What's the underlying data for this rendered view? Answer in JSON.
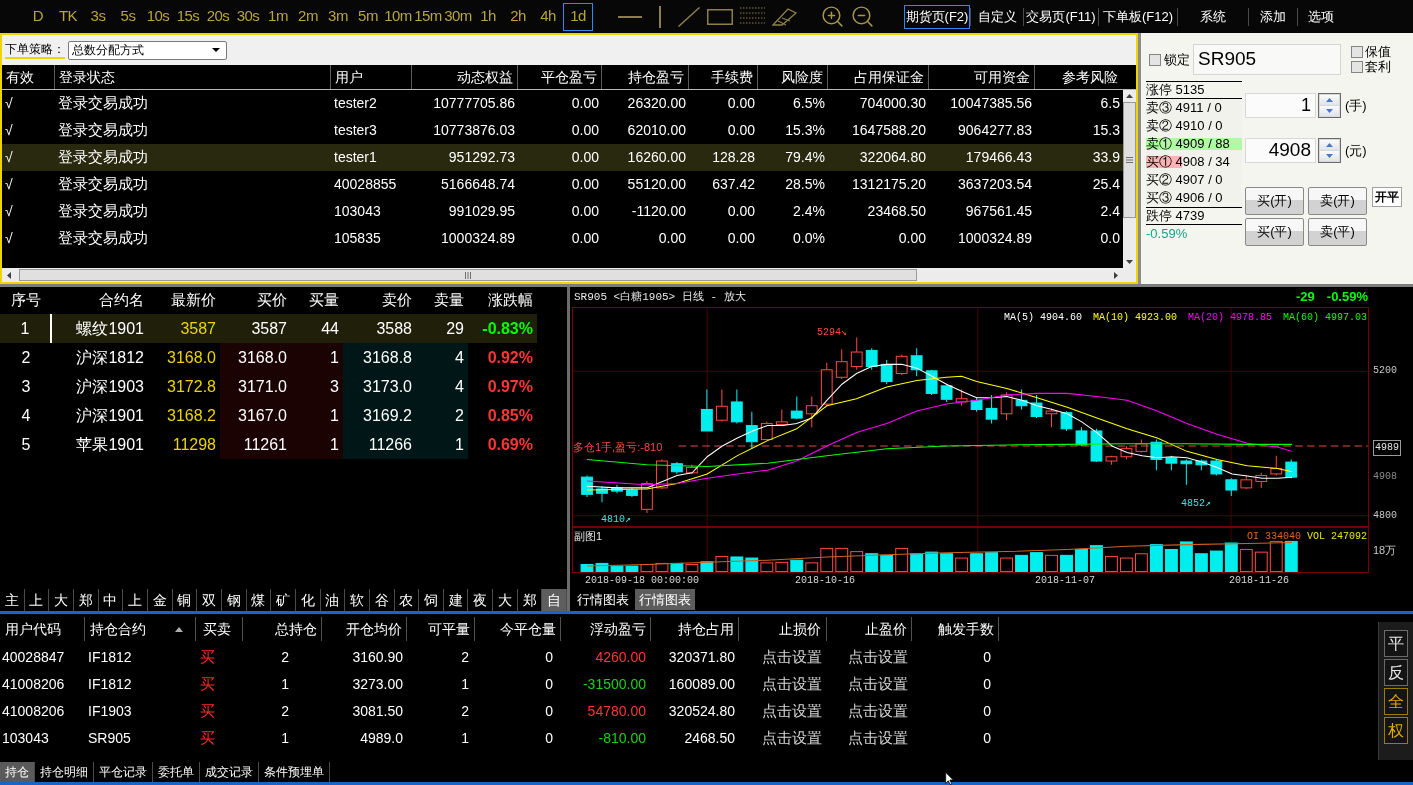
{
  "toolbar": {
    "periods": [
      {
        "label": "D",
        "selected": false
      },
      {
        "label": "TK",
        "selected": false
      },
      {
        "label": "3s",
        "selected": false
      },
      {
        "label": "5s",
        "selected": false
      },
      {
        "label": "10s",
        "selected": false
      },
      {
        "label": "15s",
        "selected": false
      },
      {
        "label": "20s",
        "selected": false
      },
      {
        "label": "30s",
        "selected": false
      },
      {
        "label": "1m",
        "selected": false
      },
      {
        "label": "2m",
        "selected": false
      },
      {
        "label": "3m",
        "selected": false
      },
      {
        "label": "5m",
        "selected": false
      },
      {
        "label": "10m",
        "selected": false
      },
      {
        "label": "15m",
        "selected": false
      },
      {
        "label": "30m",
        "selected": false
      },
      {
        "label": "1h",
        "selected": false
      },
      {
        "label": "2h",
        "selected": false
      },
      {
        "label": "4h",
        "selected": false
      },
      {
        "label": "1d",
        "selected": true
      }
    ],
    "menus": [
      {
        "label": "期货页(F2)",
        "selected": true
      },
      {
        "label": "自定义",
        "selected": false
      },
      {
        "label": "交易页(F11)",
        "selected": false
      },
      {
        "label": "下单板(F12)",
        "selected": false
      },
      {
        "label": "系统",
        "selected": false
      },
      {
        "label": "添加",
        "selected": false
      },
      {
        "label": "选项",
        "selected": false
      }
    ]
  },
  "accounts": {
    "strategy_label": "下单策略：",
    "strategy_value": "总数分配方式",
    "columns": [
      "有效",
      "登录状态",
      "用户",
      "动态权益",
      "平仓盈亏",
      "持仓盈亏",
      "手续费",
      "风险度",
      "占用保证金",
      "可用资金",
      "参考风险"
    ],
    "rows": [
      {
        "cells": [
          "√",
          "登录交易成功",
          "tester2",
          "10777705.86",
          "0.00",
          "26320.00",
          "0.00",
          "6.5%",
          "704000.30",
          "10047385.56",
          "6.5"
        ],
        "selected": false
      },
      {
        "cells": [
          "√",
          "登录交易成功",
          "tester3",
          "10773876.03",
          "0.00",
          "62010.00",
          "0.00",
          "15.3%",
          "1647588.20",
          "9064277.83",
          "15.3"
        ],
        "selected": false
      },
      {
        "cells": [
          "√",
          "登录交易成功",
          "tester1",
          "951292.73",
          "0.00",
          "16260.00",
          "128.28",
          "79.4%",
          "322064.80",
          "179466.43",
          "33.9"
        ],
        "selected": true
      },
      {
        "cells": [
          "√",
          "登录交易成功",
          "40028855",
          "5166648.74",
          "0.00",
          "55120.00",
          "637.42",
          "28.5%",
          "1312175.20",
          "3637203.54",
          "25.4"
        ],
        "selected": false
      },
      {
        "cells": [
          "√",
          "登录交易成功",
          "103043",
          "991029.95",
          "0.00",
          "-1120.00",
          "0.00",
          "2.4%",
          "23468.50",
          "967561.45",
          "2.4"
        ],
        "selected": false
      },
      {
        "cells": [
          "√",
          "登录交易成功",
          "105835",
          "1000324.89",
          "0.00",
          "0.00",
          "0.00",
          "0.0%",
          "0.00",
          "1000324.89",
          "0.0"
        ],
        "selected": false
      }
    ]
  },
  "order_panel": {
    "lock": {
      "label": "锁定",
      "checked": false
    },
    "symbol": "SR905",
    "hedge": {
      "label": "保值",
      "checked": false
    },
    "arbitrage": {
      "label": "套利",
      "checked": false
    },
    "book": [
      {
        "kind": "limit",
        "text": "涨停 5135"
      },
      {
        "kind": "sell",
        "text": "卖③ 4911 / 0",
        "level": 0
      },
      {
        "kind": "sell",
        "text": "卖② 4910 / 0",
        "level": 0
      },
      {
        "kind": "sell",
        "text": "卖① 4909 / 88",
        "level": 1
      },
      {
        "kind": "buy",
        "text": "买① 4908 / 34",
        "level": 0.37
      },
      {
        "kind": "buy",
        "text": "买② 4907 / 0",
        "level": 0
      },
      {
        "kind": "buy",
        "text": "买③ 4906 / 0",
        "level": 0
      },
      {
        "kind": "limit",
        "text": "跌停 4739"
      },
      {
        "kind": "change",
        "text": "-0.59%"
      }
    ],
    "quantity": {
      "value": "1",
      "unit": "(手)"
    },
    "price": {
      "value": "4908",
      "unit": "(元)"
    },
    "buttons": [
      "买(开)",
      "卖(开)",
      "买(平)",
      "卖(平)"
    ],
    "mode_button": "开平"
  },
  "quotes": {
    "columns": [
      "序号",
      "合约名",
      "最新价",
      "买价",
      "买量",
      "卖价",
      "卖量",
      "涨跌幅"
    ],
    "rows": [
      {
        "cells": [
          "1",
          "螺纹1901",
          "3587",
          "3587",
          "44",
          "3588",
          "29",
          "-0.83%"
        ],
        "color": "#00ff00",
        "selected": true
      },
      {
        "cells": [
          "2",
          "沪深1812",
          "3168.0",
          "3168.0",
          "1",
          "3168.8",
          "4",
          "0.92%"
        ],
        "color": "#ff3535",
        "selected": false
      },
      {
        "cells": [
          "3",
          "沪深1903",
          "3172.8",
          "3171.0",
          "3",
          "3173.0",
          "4",
          "0.97%"
        ],
        "color": "#ff3535",
        "selected": false
      },
      {
        "cells": [
          "4",
          "沪深1901",
          "3168.2",
          "3167.0",
          "1",
          "3169.2",
          "2",
          "0.85%"
        ],
        "color": "#ff3535",
        "selected": false
      },
      {
        "cells": [
          "5",
          "苹果1901",
          "11298",
          "11261",
          "1",
          "11266",
          "1",
          "0.69%"
        ],
        "color": "#ff3535",
        "selected": false
      }
    ],
    "exchange_tabs": [
      {
        "label": "主",
        "selected": false
      },
      {
        "label": "上",
        "selected": false
      },
      {
        "label": "大",
        "selected": false
      },
      {
        "label": "郑",
        "selected": false
      },
      {
        "label": "中",
        "selected": false
      },
      {
        "label": "上",
        "selected": false
      },
      {
        "label": "金",
        "selected": false
      },
      {
        "label": "铜",
        "selected": false
      },
      {
        "label": "双",
        "selected": false
      },
      {
        "label": "钢",
        "selected": false
      },
      {
        "label": "煤",
        "selected": false
      },
      {
        "label": "矿",
        "selected": false
      },
      {
        "label": "化",
        "selected": false
      },
      {
        "label": "油",
        "selected": false
      },
      {
        "label": "软",
        "selected": false
      },
      {
        "label": "谷",
        "selected": false
      },
      {
        "label": "农",
        "selected": false
      },
      {
        "label": "饲",
        "selected": false
      },
      {
        "label": "建",
        "selected": false
      },
      {
        "label": "夜",
        "selected": false
      },
      {
        "label": "大",
        "selected": false
      },
      {
        "label": "郑",
        "selected": false
      },
      {
        "label": "自",
        "selected": true
      }
    ]
  },
  "chart": {
    "title": "SR905 <白糖1905> 日线 - 放大",
    "change": {
      "text": "-29",
      "color": "#00ff00"
    },
    "change_percent": {
      "text": "-0.59%",
      "color": "#00ff00"
    },
    "moving_averages": [
      {
        "label": "MA(5) 4904.60",
        "color": "#ffffff"
      },
      {
        "label": "MA(10) 4923.00",
        "color": "#ffff00"
      },
      {
        "label": "MA(20) 4978.85",
        "color": "#ff00ff"
      },
      {
        "label": "MA(60) 4997.03",
        "color": "#00ff00"
      }
    ],
    "high_label": "5294↘",
    "low_labels": [
      "4810↗",
      "4852↗"
    ],
    "position_label": "多仓1手,盈亏:-810",
    "price_axis": [
      {
        "label": "5200",
        "kind": "tick"
      },
      {
        "label": "4989",
        "kind": "position"
      },
      {
        "label": "4908",
        "kind": "last"
      },
      {
        "label": "4800",
        "kind": "tick"
      }
    ],
    "sub_title": "副图1",
    "open_interest": "OI 334040",
    "volume": "VOL 247092",
    "volume_axis": "18万",
    "dates": [
      "2018-09-18 00:00:00",
      "2018-10-16",
      "2018-11-07",
      "2018-11-26"
    ],
    "tabs": [
      {
        "label": "行情图表",
        "selected": false
      },
      {
        "label": "行情图表",
        "selected": true
      }
    ]
  },
  "positions": {
    "columns": [
      {
        "label": "用户代码",
        "sorted": false
      },
      {
        "label": "持仓合约",
        "sorted": true
      },
      {
        "label": "买卖",
        "sorted": false
      },
      {
        "label": "总持仓",
        "sorted": false
      },
      {
        "label": "开仓均价",
        "sorted": false
      },
      {
        "label": "可平量",
        "sorted": false
      },
      {
        "label": "今平仓量",
        "sorted": false
      },
      {
        "label": "浮动盈亏",
        "sorted": false
      },
      {
        "label": "持仓占用",
        "sorted": false
      },
      {
        "label": "止损价",
        "sorted": false
      },
      {
        "label": "止盈价",
        "sorted": false
      },
      {
        "label": "触发手数",
        "sorted": false
      }
    ],
    "rows": [
      {
        "cells": [
          "40028847",
          "IF1812",
          "买",
          "2",
          "3160.90",
          "2",
          "0",
          "4260.00",
          "320371.80",
          "点击设置",
          "点击设置",
          "0"
        ],
        "color": "#ff3535"
      },
      {
        "cells": [
          "41008206",
          "IF1812",
          "买",
          "1",
          "3273.00",
          "1",
          "0",
          "-31500.00",
          "160089.00",
          "点击设置",
          "点击设置",
          "0"
        ],
        "color": "#19d219"
      },
      {
        "cells": [
          "41008206",
          "IF1903",
          "买",
          "2",
          "3081.50",
          "2",
          "0",
          "54780.00",
          "320524.80",
          "点击设置",
          "点击设置",
          "0"
        ],
        "color": "#ff3535"
      },
      {
        "cells": [
          "103043",
          "SR905",
          "买",
          "1",
          "4989.0",
          "1",
          "0",
          "-810.00",
          "2468.50",
          "点击设置",
          "点击设置",
          "0"
        ],
        "color": "#19d219"
      }
    ]
  },
  "side_buttons": [
    {
      "label": "平",
      "on": false
    },
    {
      "label": "反",
      "on": false
    },
    {
      "label": "全",
      "on": true
    },
    {
      "label": "权",
      "on": true
    }
  ],
  "bottom_tabs": [
    {
      "label": "持仓",
      "selected": true
    },
    {
      "label": "持仓明细",
      "selected": false
    },
    {
      "label": "平仓记录",
      "selected": false
    },
    {
      "label": "委托单",
      "selected": false
    },
    {
      "label": "成交记录",
      "selected": false
    },
    {
      "label": "条件预埋单",
      "selected": false
    }
  ]
}
